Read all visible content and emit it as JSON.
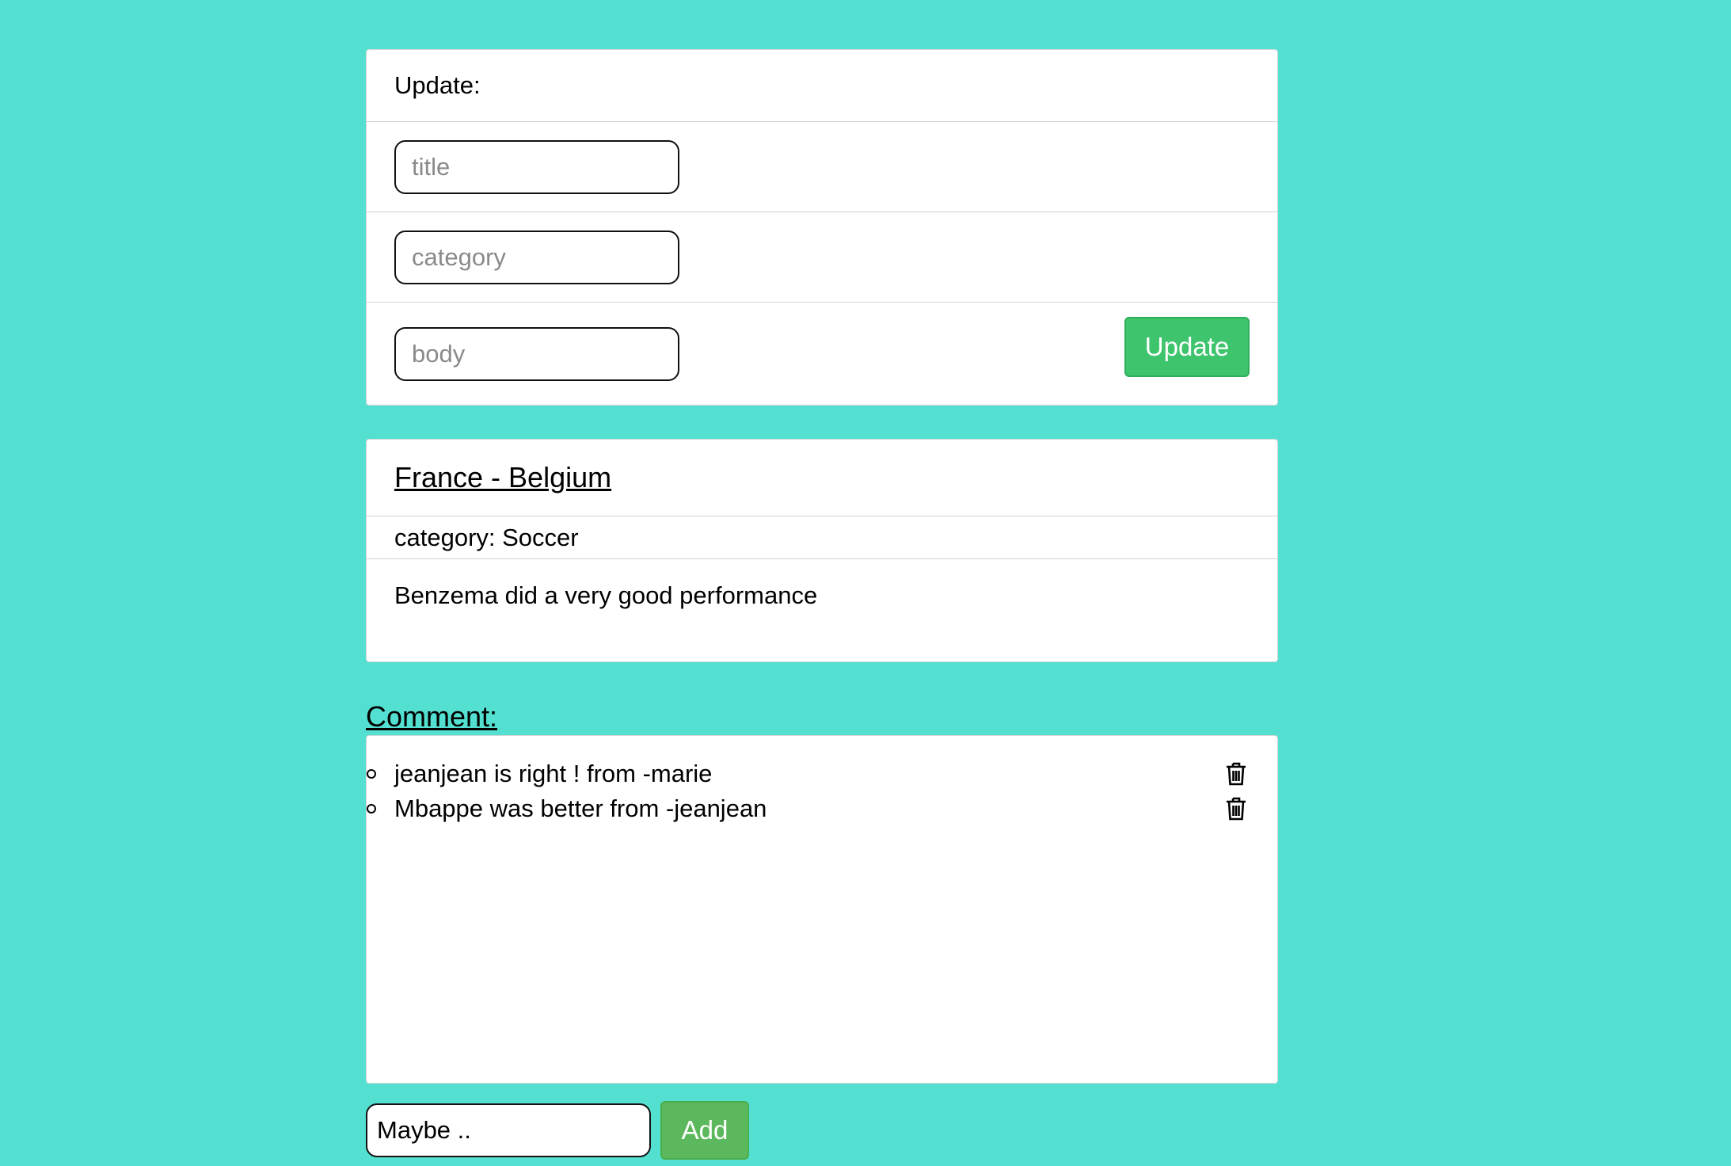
{
  "update_form": {
    "heading": "Update:",
    "title_placeholder": "title",
    "category_placeholder": "category",
    "body_placeholder": "body",
    "submit_label": "Update"
  },
  "post": {
    "title": "France - Belgium",
    "category": "category: Soccer",
    "body": "Benzema did a very good performance"
  },
  "comments": {
    "heading": "Comment:",
    "items": [
      {
        "text": "jeanjean is right ! from -marie",
        "delete_icon": "trash-icon"
      },
      {
        "text": "Mbappe was better from -jeanjean",
        "delete_icon": "trash-icon"
      }
    ],
    "new_comment_value": "Maybe ..",
    "add_label": "Add"
  },
  "colors": {
    "background": "#53e0d0",
    "update_button": "#3dc46c",
    "add_button": "#5cb85c"
  }
}
